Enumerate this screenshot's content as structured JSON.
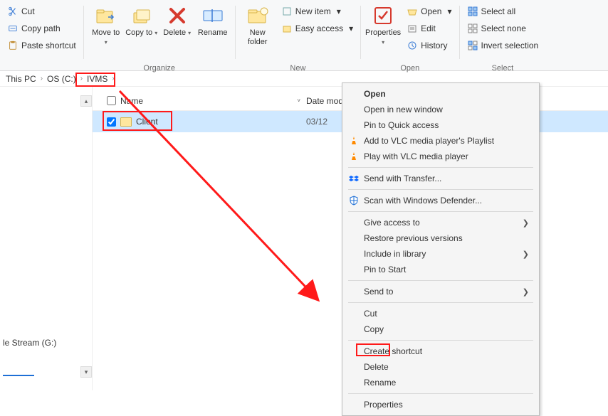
{
  "ribbon": {
    "clipboard": {
      "cut": "Cut",
      "copy_path": "Copy path",
      "paste_shortcut": "Paste shortcut"
    },
    "organize": {
      "move_to": "Move to",
      "copy_to": "Copy to",
      "delete": "Delete",
      "rename": "Rename",
      "label": "Organize"
    },
    "new": {
      "new_folder": "New folder",
      "new_item": "New item",
      "easy_access": "Easy access",
      "label": "New",
      "drop": "▾"
    },
    "open_grp": {
      "properties": "Properties",
      "open": "Open",
      "edit": "Edit",
      "history": "History",
      "label": "Open",
      "drop": "▾"
    },
    "select_grp": {
      "select_all": "Select all",
      "select_none": "Select none",
      "invert": "Invert selection",
      "label": "Select"
    }
  },
  "breadcrumb": {
    "a": "This PC",
    "b": "OS (C:)",
    "c": "IVMS",
    "sep": "›"
  },
  "header": {
    "name": "Name",
    "date": "Date modified",
    "drop": "˅"
  },
  "rows": [
    {
      "name": "Client",
      "date": "03/12"
    }
  ],
  "gutter": {
    "stream": "le Stream (G:)"
  },
  "ctx": {
    "open": "Open",
    "open_new": "Open in new window",
    "pin_quick": "Pin to Quick access",
    "vlc_playlist": "Add to VLC media player's Playlist",
    "vlc_play": "Play with VLC media player",
    "send_transfer": "Send with Transfer...",
    "scan_defender": "Scan with Windows Defender...",
    "give_access": "Give access to",
    "restore_prev": "Restore previous versions",
    "include_lib": "Include in library",
    "pin_start": "Pin to Start",
    "send_to": "Send to",
    "cut": "Cut",
    "copy": "Copy",
    "create_shortcut": "Create shortcut",
    "delete": "Delete",
    "rename": "Rename",
    "properties": "Properties",
    "arrow": "❯"
  }
}
